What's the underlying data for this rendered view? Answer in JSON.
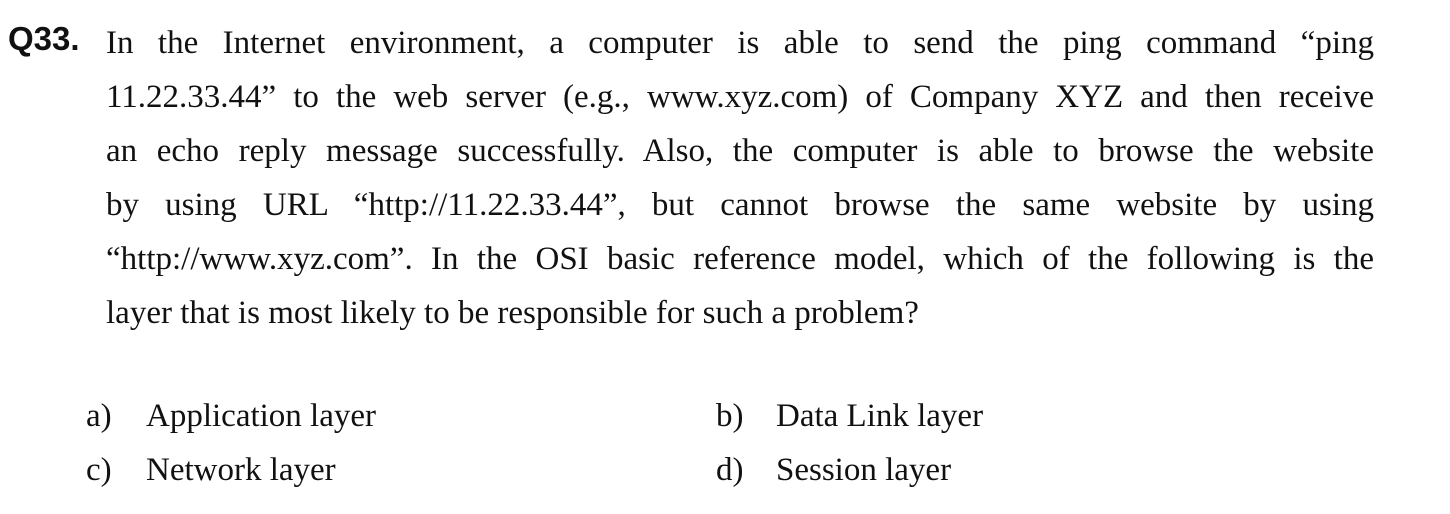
{
  "question": {
    "number": "Q33.",
    "lines": [
      "In the Internet environment, a computer is able to send the ping command “ping",
      "11.22.33.44” to the web server (e.g., www.xyz.com) of Company XYZ and then receive",
      "an echo reply message successfully.   Also, the computer is able to browse the website",
      "by using URL “http://11.22.33.44”, but cannot browse the same website by using",
      "“http://www.xyz.com”.   In the OSI basic reference model, which of the following is the",
      "layer that is most likely to be responsible for such a problem?"
    ]
  },
  "options": {
    "a": {
      "letter": "a)",
      "text": "Application layer"
    },
    "b": {
      "letter": "b)",
      "text": "Data Link layer"
    },
    "c": {
      "letter": "c)",
      "text": "Network layer"
    },
    "d": {
      "letter": "d)",
      "text": "Session layer"
    }
  }
}
